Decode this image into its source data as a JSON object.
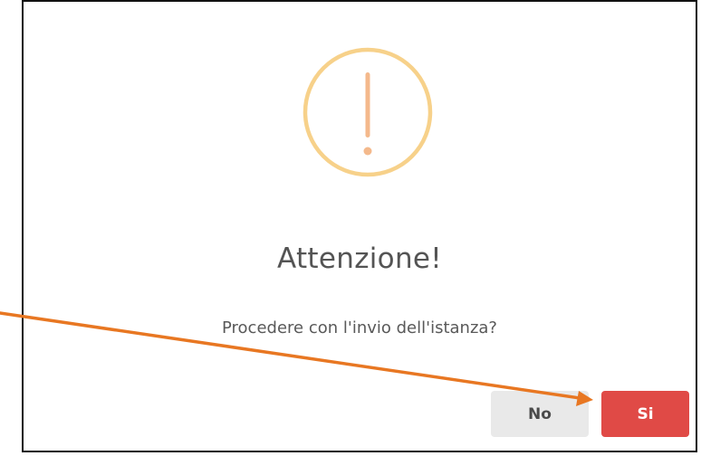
{
  "dialog": {
    "icon": "exclamation-circle-icon",
    "title": "Attenzione!",
    "message": "Procedere con l'invio dell'istanza?",
    "buttons": {
      "no_label": "No",
      "yes_label": "Si"
    }
  },
  "colors": {
    "icon_ring": "#f7d18a",
    "icon_mark": "#f4b98c",
    "confirm_button": "#e04a46",
    "cancel_button": "#e9e9e9",
    "annotation_arrow": "#e87722"
  },
  "annotation": {
    "type": "arrow",
    "points_to": "confirm-button"
  }
}
